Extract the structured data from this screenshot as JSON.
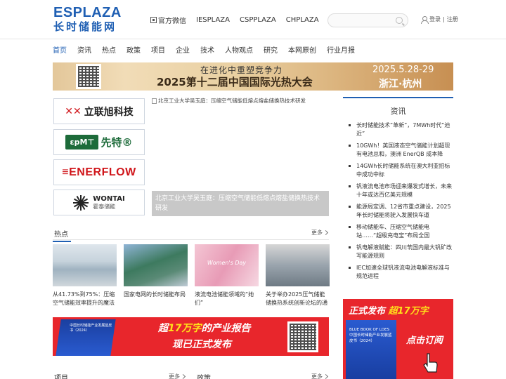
{
  "header": {
    "logo_top": "ESPLAZA",
    "logo_bottom": "长时储能网",
    "links": [
      "官方微信",
      "IESPLAZA",
      "CSPPLAZA",
      "CHPLAZA"
    ],
    "search_placeholder": "",
    "login_label": "登录",
    "separator": "|",
    "register_label": "注册"
  },
  "nav": {
    "items": [
      "首页",
      "资讯",
      "热点",
      "政策",
      "项目",
      "企业",
      "技术",
      "人物观点",
      "研究",
      "本网原创",
      "行业月报"
    ],
    "active_index": 0
  },
  "banner": {
    "line1": "在进化中重塑竞争力",
    "line2": "2025第十二届中国国际光热大会",
    "date": "2025.5.28-29",
    "place": "浙江·杭州"
  },
  "partners": {
    "lianxu_mark": "✕✕",
    "lianxu_text": "立联旭科技",
    "cpmt_mark": "ɛpM⊤",
    "cpmt_text": "先特®",
    "enerflow": "≡ENERFLOW",
    "wontai_en": "WONTAI",
    "wontai_cn": "霍泰储能"
  },
  "feature": {
    "top_caption": "北京工业大学吴玉庭：压缩空气储能低熔点熔盐储换热技术研发",
    "overlay_text": "北京工业大学吴玉庭：压缩空气储能低熔点熔盐储换热技术研发"
  },
  "news": {
    "title": "资讯",
    "items": [
      "长时储能技术“革新”，7MWh时代“迫近”",
      "10GWh！英国液态空气储能计划超现有电池总和，澳洲 EnerQB 成本降",
      "14GWh长时储能系统在澳大利亚招标中成功中标",
      "钒液流电池市场迎来爆发式增长，未来十年或达百亿美元规模",
      "能源局定调、12省市重点建设，2025年长时储能将驶入发展快车道",
      "移动储能车、压缩空气储能电站……“超级充电宝”布局全国",
      "钒电解液赋能：四川茕国内最大钒矿改写能源规则",
      "IEC加速全球钒液流电池电解液标准与规范进程"
    ]
  },
  "hot": {
    "title": "热点",
    "more": "更多",
    "cards": [
      {
        "caption": "从41.73%到75%：压缩空气储能效率提升的魔法",
        "img_label": ""
      },
      {
        "caption": "国家电网的长时储能布局",
        "img_label": ""
      },
      {
        "caption": "液流电池储能领域的“她们”",
        "img_label": "Women's Day"
      },
      {
        "caption": "关于举办2025压气储能储换热系统创新论坛的通知",
        "img_label": ""
      }
    ]
  },
  "report": {
    "line1_prefix": "超",
    "line1_highlight": "17万字",
    "line1_suffix": "的产业报告",
    "line2": "现已正式发布",
    "book_text": "中国长时储能产业发展蓝皮书（2024）"
  },
  "sidead": {
    "line1_prefix": "正式发布",
    "line1_highlight": "超17万字",
    "book_title": "BLUE BOOK OF LDES 中国长时储能产业发展蓝皮书（2024）",
    "cta": "点击订阅"
  },
  "bottom": {
    "left_title": "项目",
    "right_title": "政策",
    "more": "更多"
  }
}
